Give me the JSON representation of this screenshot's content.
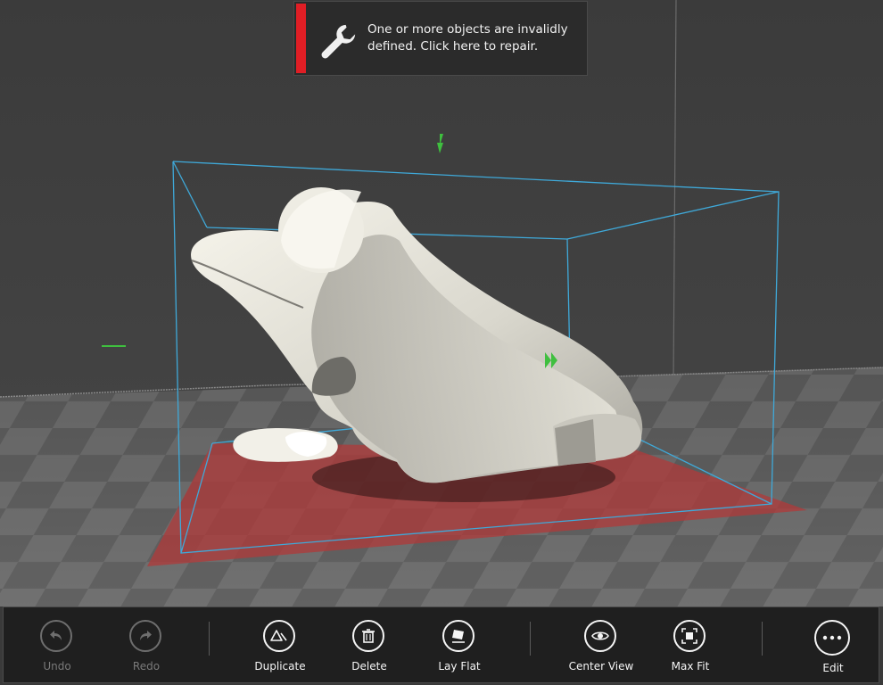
{
  "notification": {
    "message": "One or more objects are invalidly defined. Click here to repair.",
    "icon": "wrench-icon",
    "accent_color": "#e01e25"
  },
  "viewport": {
    "selection_box_color": "#3fa9d9",
    "build_plate_color": "#b03a3a",
    "gizmo_color": "#3fbf3f"
  },
  "toolbar": {
    "undo_label": "Undo",
    "redo_label": "Redo",
    "duplicate_label": "Duplicate",
    "delete_label": "Delete",
    "lay_flat_label": "Lay Flat",
    "center_view_label": "Center View",
    "max_fit_label": "Max Fit",
    "edit_label": "Edit"
  }
}
